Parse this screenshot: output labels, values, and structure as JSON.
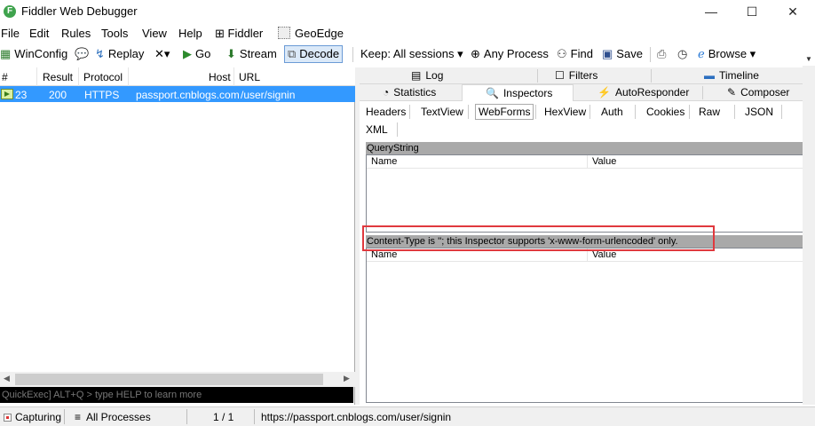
{
  "window": {
    "app_icon_letter": "F",
    "title": "Fiddler Web Debugger",
    "minimize": "—",
    "maximize": "☐",
    "close": "✕"
  },
  "menu": {
    "items": [
      "File",
      "Edit",
      "Rules",
      "Tools",
      "View",
      "Help",
      "Fiddler",
      "GeoEdge"
    ]
  },
  "toolbar": {
    "winconfig": "WinConfig",
    "replay": "Replay",
    "remove": "✕▾",
    "go": "Go",
    "stream": "Stream",
    "decode": "Decode",
    "keep": "Keep: All sessions",
    "any_process": "Any Process",
    "find": "Find",
    "save": "Save",
    "browse": "Browse"
  },
  "sessions": {
    "columns": [
      "#",
      "Result",
      "Protocol",
      "Host",
      "URL"
    ],
    "rows": [
      {
        "id": "23",
        "result": "200",
        "protocol": "HTTPS",
        "host": "passport.cnblogs.com",
        "url": "/user/signin"
      }
    ]
  },
  "quickexec": {
    "placeholder": "QuickExec] ALT+Q > type HELP to learn more"
  },
  "tabs_row1": {
    "log": "Log",
    "filters": "Filters",
    "timeline": "Timeline"
  },
  "tabs_row2": {
    "statistics": "Statistics",
    "inspectors": "Inspectors",
    "autoresponder": "AutoResponder",
    "composer": "Composer"
  },
  "inspector_tabs": [
    "Headers",
    "TextView",
    "WebForms",
    "HexView",
    "Auth",
    "Cookies",
    "Raw",
    "JSON",
    "XML"
  ],
  "querystring": {
    "title": "QueryString",
    "col_name": "Name",
    "col_value": "Value"
  },
  "body_panel": {
    "message": "Content-Type is ''; this Inspector supports 'x-www-form-urlencoded' only.",
    "col_name": "Name",
    "col_value": "Value"
  },
  "status": {
    "capturing": "Capturing",
    "processes": "All Processes",
    "count": "1 / 1",
    "url": "https://passport.cnblogs.com/user/signin"
  },
  "colors": {
    "selection": "#3399ff",
    "highlight_border": "#e0393e",
    "panel_header": "#a9a9a9"
  }
}
